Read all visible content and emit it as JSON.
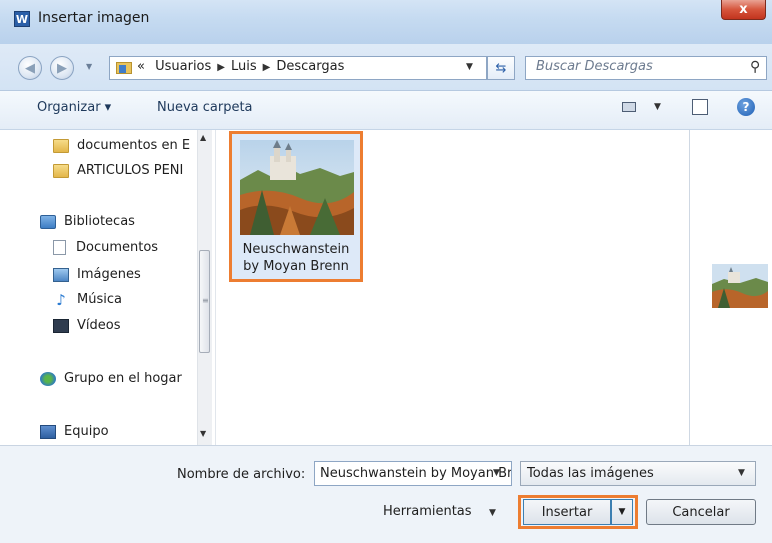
{
  "window": {
    "title": "Insertar imagen",
    "app_icon_letter": "W",
    "close_symbol": "x"
  },
  "address": {
    "prefix": "«",
    "path": [
      "Usuarios",
      "Luis",
      "Descargas"
    ],
    "search_placeholder": "Buscar Descargas"
  },
  "toolbar": {
    "organize_label": "Organizar ▾",
    "new_folder_label": "Nueva carpeta"
  },
  "nav": {
    "items": [
      {
        "label": "documentos en E",
        "icon": "folder-icon"
      },
      {
        "label": "ARTICULOS PENI",
        "icon": "folder-icon"
      },
      {
        "label": "Bibliotecas",
        "icon": "libraries-icon"
      },
      {
        "label": "Documentos",
        "icon": "documents-icon"
      },
      {
        "label": "Imágenes",
        "icon": "pictures-icon"
      },
      {
        "label": "Música",
        "icon": "music-icon"
      },
      {
        "label": "Vídeos",
        "icon": "videos-icon"
      },
      {
        "label": "Grupo en el hogar",
        "icon": "homegroup-icon"
      },
      {
        "label": "Equipo",
        "icon": "computer-icon"
      }
    ]
  },
  "files": [
    {
      "name_line1": "Neuschwanstein",
      "name_line2": "by Moyan Brenn",
      "selected": true
    }
  ],
  "bottom": {
    "filename_label": "Nombre de archivo:",
    "filename_value": "Neuschwanstein by Moyan Brenn",
    "filetype_value": "Todas las imágenes",
    "tools_label": "Herramientas",
    "insert_label": "Insertar",
    "cancel_label": "Cancelar"
  },
  "colors": {
    "highlight": "#ed7d31",
    "selection": "#dde9f8"
  }
}
